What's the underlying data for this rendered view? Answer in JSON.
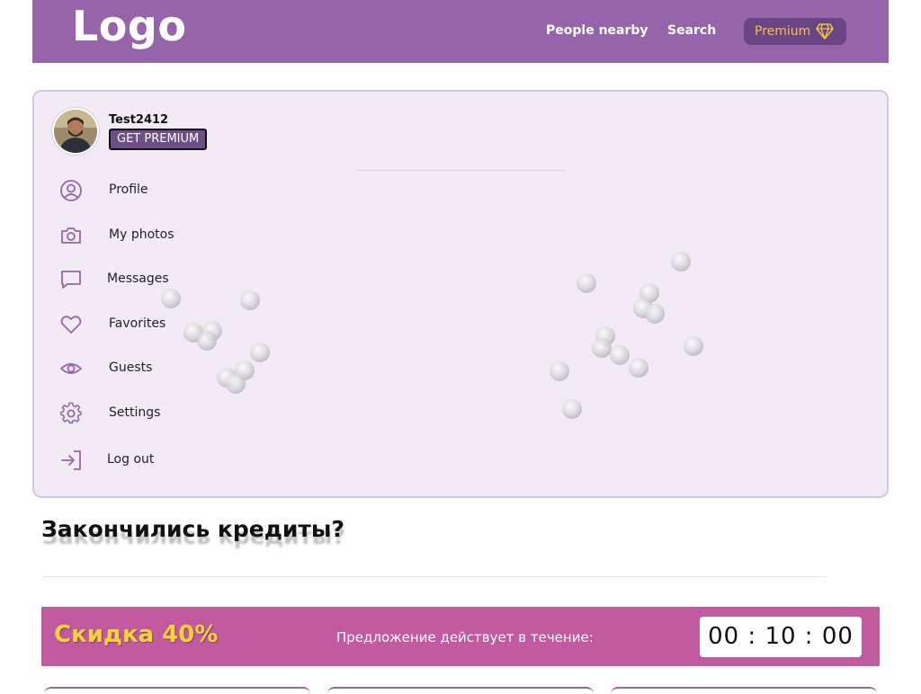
{
  "header": {
    "logo": "Logo",
    "nav": [
      {
        "label": "People nearby"
      },
      {
        "label": "Search"
      }
    ],
    "premium": {
      "label": "Premium",
      "icon": "diamond-icon"
    }
  },
  "user": {
    "username": "Test2412",
    "get_premium_label": "GET PREMIUM"
  },
  "menu": [
    {
      "label": "Profile",
      "icon": "user-circle-icon"
    },
    {
      "label": "My photos",
      "icon": "camera-icon"
    },
    {
      "label": "Messages",
      "icon": "message-icon"
    },
    {
      "label": "Favorites",
      "icon": "heart-icon"
    },
    {
      "label": "Guests",
      "icon": "eye-icon"
    },
    {
      "label": "Settings",
      "icon": "gear-icon"
    },
    {
      "label": "Log out",
      "icon": "logout-icon"
    }
  ],
  "credits": {
    "title": "Закончились кредиты?"
  },
  "offer": {
    "discount": "Скидка 40%",
    "text": "Предложение действует в течение:",
    "timer": "00 : 10 : 00"
  },
  "colors": {
    "header": "#9664ab",
    "panel": "#f2ebf5",
    "offer_bar": "#c15a9e",
    "discount": "#f5d23a",
    "icon": "#9664ab"
  }
}
